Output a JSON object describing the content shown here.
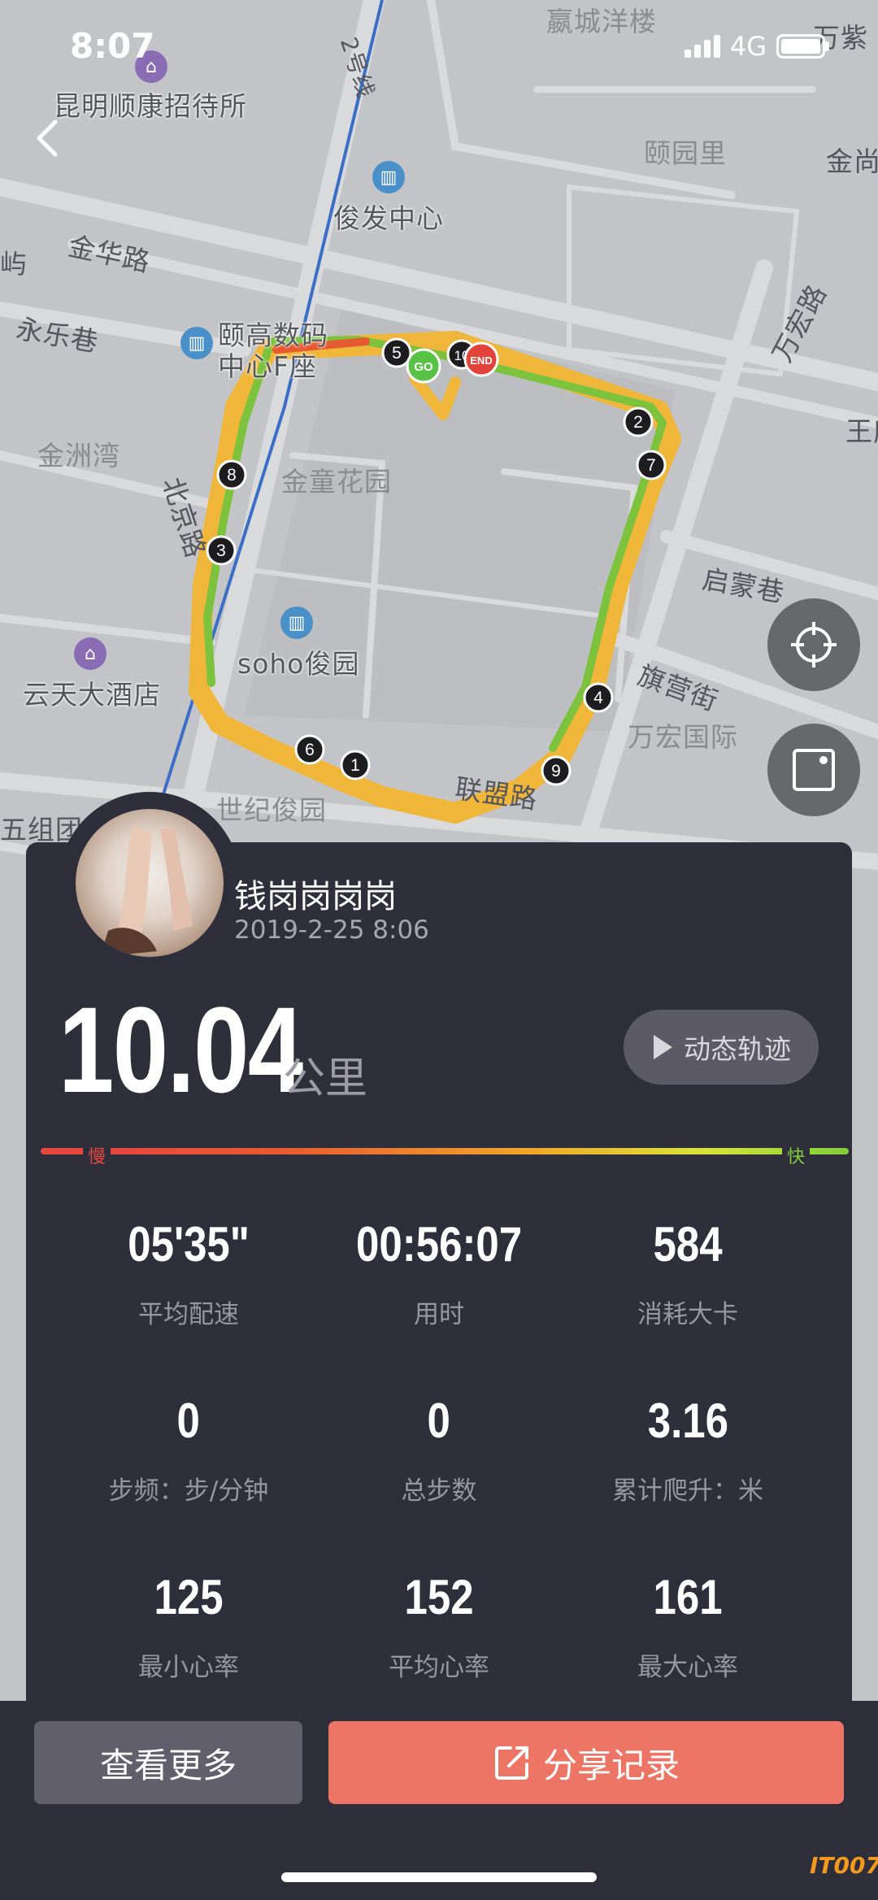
{
  "status_bar": {
    "time": "8:07",
    "network": "4G"
  },
  "map": {
    "labels": {
      "kunming_hotel": "昆明顺康招待所",
      "yingcheng": "嬴城洋楼",
      "wanzi": "万紫",
      "yiyuanli": "颐园里",
      "jinshang": "金尚",
      "junfa": "俊发中心",
      "jinhua_road": "金华路",
      "yu": "屿",
      "yongle": "永乐巷",
      "yigao_1": "颐高数码",
      "yigao_2": "中心F座",
      "jinzhou": "金洲湾",
      "jintong": "金童花园",
      "beijing_road": "北京路",
      "wanhong_road": "万宏路",
      "wang": "王府",
      "qimeng": "启蒙巷",
      "soho": "soho俊园",
      "yuntian": "云天大酒店",
      "qiying": "旗营街",
      "wanhong_intl": "万宏国际",
      "shiji": "世纪俊园",
      "wuzu": "五组团",
      "lianmeng": "联盟路",
      "line2": "2号线"
    },
    "route_markers": {
      "go": "GO",
      "end": "END",
      "km": [
        "1",
        "2",
        "3",
        "4",
        "5",
        "6",
        "7",
        "8",
        "9",
        "10"
      ]
    }
  },
  "user": {
    "name": "钱岗岗岗岗",
    "date": "2019-2-25 8:06"
  },
  "run": {
    "distance": "10.04",
    "distance_unit": "公里",
    "replay_label": "动态轨迹",
    "slow_label": "慢",
    "fast_label": "快"
  },
  "stats": [
    {
      "value": "05'35\"",
      "label": "平均配速"
    },
    {
      "value": "00:56:07",
      "label": "用时"
    },
    {
      "value": "584",
      "label": "消耗大卡"
    },
    {
      "value": "0",
      "label": "步频：步/分钟"
    },
    {
      "value": "0",
      "label": "总步数"
    },
    {
      "value": "3.16",
      "label": "累计爬升：米"
    },
    {
      "value": "125",
      "label": "最小心率"
    },
    {
      "value": "152",
      "label": "平均心率"
    },
    {
      "value": "161",
      "label": "最大心率"
    }
  ],
  "actions": {
    "more": "查看更多",
    "share": "分享记录"
  },
  "watermark": "IT007",
  "colors": {
    "slow": "#e6493d",
    "fast": "#7fcf3c",
    "share": "#ec7566",
    "card": "#2f2e3b"
  }
}
